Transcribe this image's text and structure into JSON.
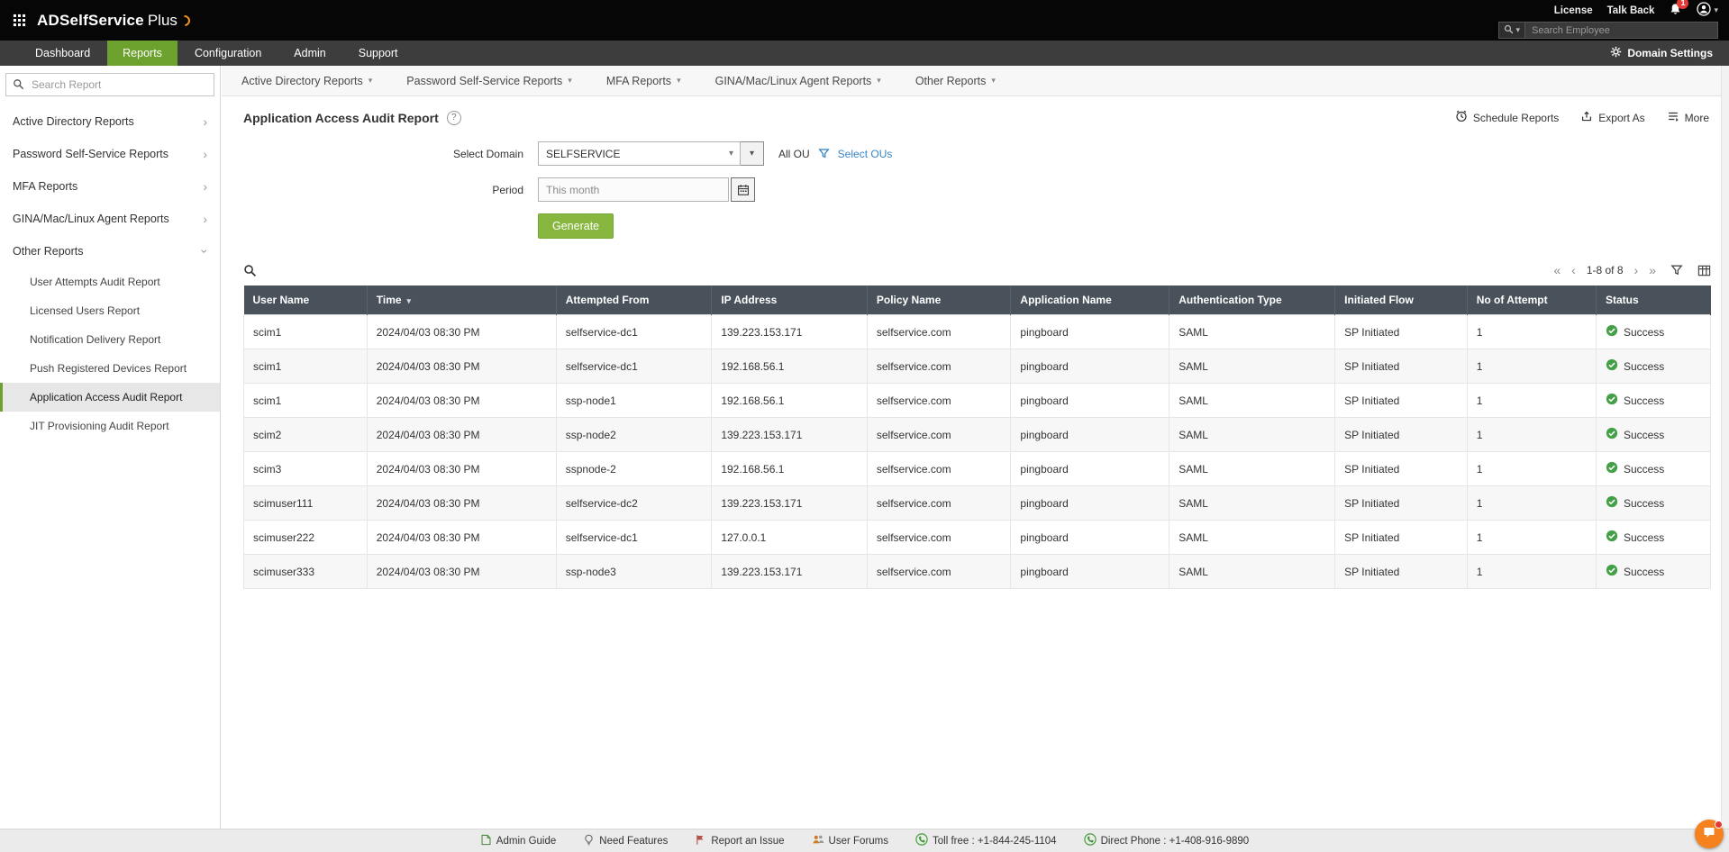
{
  "topbar": {
    "logo_primary": "ADSelfService",
    "logo_plus": "Plus",
    "license": "License",
    "talkback": "Talk Back",
    "badge_count": "1",
    "search_placeholder": "Search Employee"
  },
  "nav": {
    "tabs": [
      "Dashboard",
      "Reports",
      "Configuration",
      "Admin",
      "Support"
    ],
    "active_tab": "Reports",
    "domain_settings": "Domain Settings"
  },
  "sidebar": {
    "search_placeholder": "Search Report",
    "groups": [
      "Active Directory Reports",
      "Password Self-Service Reports",
      "MFA Reports",
      "GINA/Mac/Linux Agent Reports",
      "Other Reports"
    ],
    "other_reports": [
      "User Attempts Audit Report",
      "Licensed Users Report",
      "Notification Delivery Report",
      "Push Registered Devices Report",
      "Application Access Audit Report",
      "JIT Provisioning Audit Report"
    ],
    "selected_item": "Application Access Audit Report"
  },
  "reportnav": {
    "items": [
      "Active Directory Reports",
      "Password Self-Service Reports",
      "MFA Reports",
      "GINA/Mac/Linux Agent Reports",
      "Other Reports"
    ]
  },
  "page": {
    "title": "Application Access Audit Report",
    "actions": {
      "schedule": "Schedule Reports",
      "export": "Export As",
      "more": "More"
    }
  },
  "form": {
    "domain_label": "Select Domain",
    "domain_value": "SELFSERVICE",
    "all_ou": "All OU",
    "select_ous": "Select OUs",
    "period_label": "Period",
    "period_value": "This month",
    "generate": "Generate"
  },
  "table": {
    "pagination": "1-8 of 8",
    "headers": [
      "User Name",
      "Time",
      "Attempted From",
      "IP Address",
      "Policy Name",
      "Application Name",
      "Authentication Type",
      "Initiated Flow",
      "No of Attempt",
      "Status"
    ],
    "rows": [
      [
        "scim1",
        "2024/04/03 08:30 PM",
        "selfservice-dc1",
        "139.223.153.171",
        "selfservice.com",
        "pingboard",
        "SAML",
        "SP Initiated",
        "1",
        "Success"
      ],
      [
        "scim1",
        "2024/04/03 08:30 PM",
        "selfservice-dc1",
        "192.168.56.1",
        "selfservice.com",
        "pingboard",
        "SAML",
        "SP Initiated",
        "1",
        "Success"
      ],
      [
        "scim1",
        "2024/04/03 08:30 PM",
        "ssp-node1",
        "192.168.56.1",
        "selfservice.com",
        "pingboard",
        "SAML",
        "SP Initiated",
        "1",
        "Success"
      ],
      [
        "scim2",
        "2024/04/03 08:30 PM",
        "ssp-node2",
        "139.223.153.171",
        "selfservice.com",
        "pingboard",
        "SAML",
        "SP Initiated",
        "1",
        "Success"
      ],
      [
        "scim3",
        "2024/04/03 08:30 PM",
        "sspnode-2",
        "192.168.56.1",
        "selfservice.com",
        "pingboard",
        "SAML",
        "SP Initiated",
        "1",
        "Success"
      ],
      [
        "scimuser111",
        "2024/04/03 08:30 PM",
        "selfservice-dc2",
        "139.223.153.171",
        "selfservice.com",
        "pingboard",
        "SAML",
        "SP Initiated",
        "1",
        "Success"
      ],
      [
        "scimuser222",
        "2024/04/03 08:30 PM",
        "selfservice-dc1",
        "127.0.0.1",
        "selfservice.com",
        "pingboard",
        "SAML",
        "SP Initiated",
        "1",
        "Success"
      ],
      [
        "scimuser333",
        "2024/04/03 08:30 PM",
        "ssp-node3",
        "139.223.153.171",
        "selfservice.com",
        "pingboard",
        "SAML",
        "SP Initiated",
        "1",
        "Success"
      ]
    ]
  },
  "footer": {
    "items": [
      "Admin Guide",
      "Need Features",
      "Report an Issue",
      "User Forums",
      "Toll free : +1-844-245-1104",
      "Direct Phone : +1-408-916-9890"
    ]
  },
  "colors": {
    "accent_green": "#6ca12d",
    "button_green": "#87b73f",
    "link_blue": "#3a87c8",
    "table_header": "#49525b",
    "success_green": "#43a047",
    "brand_orange": "#f7941d"
  }
}
